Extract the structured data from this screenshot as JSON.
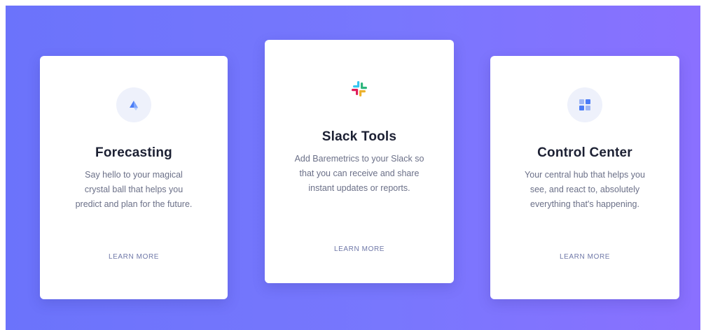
{
  "cards": [
    {
      "title": "Forecasting",
      "description": "Say hello to your magical crystal ball that helps you predict and plan for the future.",
      "cta": "LEARN MORE",
      "icon": "forecasting-icon"
    },
    {
      "title": "Slack Tools",
      "description": "Add Baremetrics to your Slack so that you can receive and share instant updates or reports.",
      "cta": "LEARN MORE",
      "icon": "slack-logo-icon"
    },
    {
      "title": "Control Center",
      "description": "Your central hub that helps you see, and react to, absolutely everything that's happening.",
      "cta": "LEARN MORE",
      "icon": "control-center-icon"
    }
  ],
  "colors": {
    "background_start": "#6b73fb",
    "background_end": "#8a70ff",
    "card": "#ffffff",
    "title": "#1c2033",
    "body_text": "#6b7088",
    "link": "#6f78a8"
  }
}
